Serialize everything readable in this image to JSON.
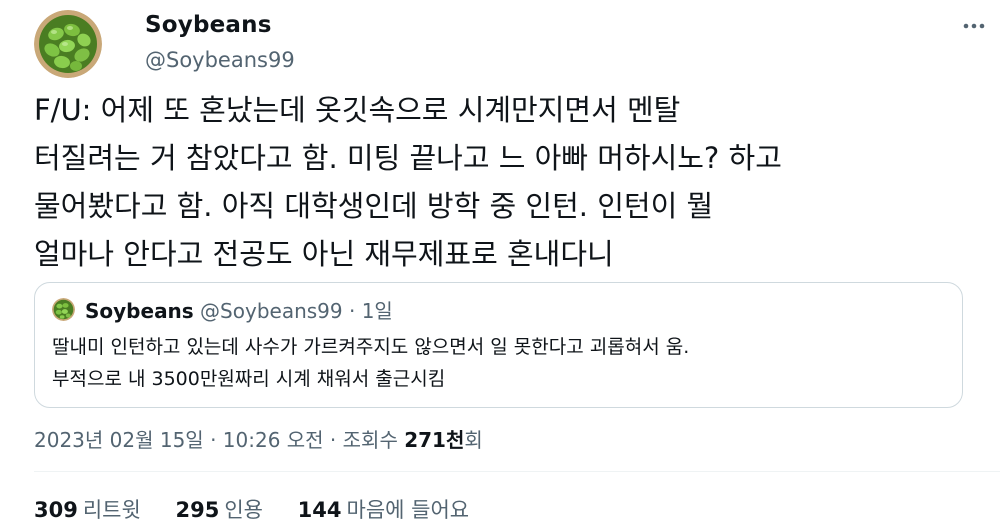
{
  "author": {
    "name": "Soybeans",
    "handle": "@Soybeans99"
  },
  "more_icon": "more-options-icon",
  "tweet": {
    "text": "F/U: 어제 또 혼났는데 옷깃속으로 시계만지면서 멘탈\n터질려는 거 참았다고 함. 미팅 끝나고 느 아빠 머하시노? 하고\n물어봤다고 함. 아직 대학생인데 방학 중 인턴. 인턴이 뭘\n얼마나 안다고 전공도 아닌 재무제표로 혼내다니"
  },
  "quoted_tweet": {
    "name": "Soybeans",
    "meta": " @Soybeans99 · 1일",
    "text": "딸내미 인턴하고 있는데 사수가 가르켜주지도 않으면서 일 못한다고 괴롭혀서 움.\n부적으로 내 3500만원짜리 시계 채워서 출근시킴"
  },
  "timestamp": {
    "datetime": "2023년 02월 15일 · 10:26 오전 · 조회수 ",
    "views_count": "271천",
    "views_suffix": "회"
  },
  "stats": {
    "retweets": {
      "count": "309",
      "label": "리트윗"
    },
    "quotes": {
      "count": "295",
      "label": "인용"
    },
    "likes": {
      "count": "144",
      "label": "마음에 들어요"
    }
  },
  "colors": {
    "text": "#0f1419",
    "secondary": "#536471",
    "border": "#cfd9de",
    "avatar_green": "#6fb83a"
  }
}
